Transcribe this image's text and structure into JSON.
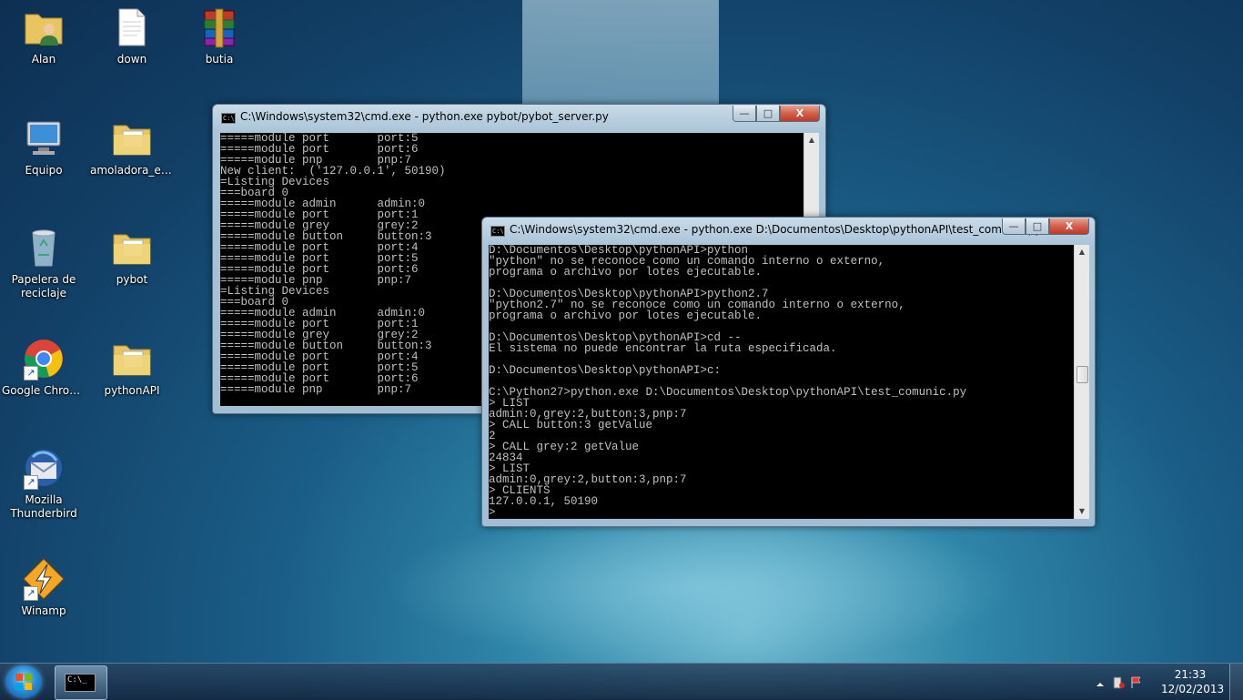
{
  "desktop": {
    "icons": [
      {
        "label": "Alan",
        "icon": "user-folder-icon"
      },
      {
        "label": "down",
        "icon": "document-icon"
      },
      {
        "label": "butia",
        "icon": "winrar-archive-icon"
      },
      {
        "label": "Equipo",
        "icon": "computer-icon"
      },
      {
        "label": "amoladora_edi...",
        "icon": "folder-icon"
      },
      {
        "label": "Papelera de reciclaje",
        "icon": "recycle-bin-icon"
      },
      {
        "label": "pybot",
        "icon": "folder-icon"
      },
      {
        "label": "Google Chrome",
        "icon": "chrome-icon"
      },
      {
        "label": "pythonAPI",
        "icon": "folder-icon"
      },
      {
        "label": "Mozilla Thunderbird",
        "icon": "thunderbird-icon"
      },
      {
        "label": "Winamp",
        "icon": "winamp-icon"
      }
    ]
  },
  "windows": {
    "server": {
      "title": "C:\\Windows\\system32\\cmd.exe - python.exe  pybot/pybot_server.py",
      "lines": [
        "=====module port       port:5",
        "=====module port       port:6",
        "=====module pnp        pnp:7",
        "New client:  ('127.0.0.1', 50190)",
        "=Listing Devices",
        "===board 0",
        "=====module admin      admin:0",
        "=====module port       port:1",
        "=====module grey       grey:2",
        "=====module button     button:3",
        "=====module port       port:4",
        "=====module port       port:5",
        "=====module port       port:6",
        "=====module pnp        pnp:7",
        "=Listing Devices",
        "===board 0",
        "=====module admin      admin:0",
        "=====module port       port:1",
        "=====module grey       grey:2",
        "=====module button     button:3",
        "=====module port       port:4",
        "=====module port       port:5",
        "=====module port       port:6",
        "=====module pnp        pnp:7"
      ]
    },
    "client": {
      "title": "C:\\Windows\\system32\\cmd.exe - python.exe  D:\\Documentos\\Desktop\\pythonAPI\\test_comunic.py",
      "lines": [
        "D:\\Documentos\\Desktop\\pythonAPI>python",
        "\"python\" no se reconoce como un comando interno o externo,",
        "programa o archivo por lotes ejecutable.",
        "",
        "D:\\Documentos\\Desktop\\pythonAPI>python2.7",
        "\"python2.7\" no se reconoce como un comando interno o externo,",
        "programa o archivo por lotes ejecutable.",
        "",
        "D:\\Documentos\\Desktop\\pythonAPI>cd --",
        "El sistema no puede encontrar la ruta especificada.",
        "",
        "D:\\Documentos\\Desktop\\pythonAPI>c:",
        "",
        "C:\\Python27>python.exe D:\\Documentos\\Desktop\\pythonAPI\\test_comunic.py",
        "> LIST",
        "admin:0,grey:2,button:3,pnp:7",
        "> CALL button:3 getValue",
        "2",
        "> CALL grey:2 getValue",
        "24834",
        "> LIST",
        "admin:0,grey:2,button:3,pnp:7",
        "> CLIENTS",
        "127.0.0.1, 50190",
        ">"
      ]
    },
    "controls": {
      "minimize": "—",
      "maximize": "□",
      "close": "X"
    }
  },
  "taskbar": {
    "start_icon": "windows-start-icon",
    "cmd_label": "C:\\_",
    "time": "21:33",
    "date": "12/02/2013"
  },
  "colors": {
    "console_bg": "#000000",
    "console_fg": "#c0c0c0",
    "close_red": "#c0392b"
  }
}
